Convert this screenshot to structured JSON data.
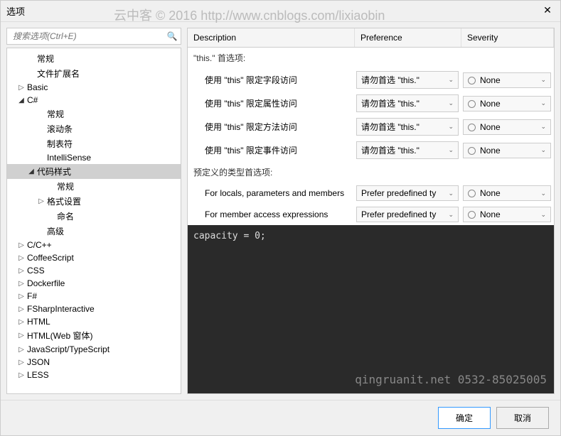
{
  "watermark": "云中客 © 2016 http://www.cnblogs.com/lixiaobin",
  "title": "选项",
  "search": {
    "placeholder": "搜索选项(Ctrl+E)"
  },
  "tree": {
    "items": [
      {
        "label": "常规",
        "indent": 2,
        "arrow": ""
      },
      {
        "label": "文件扩展名",
        "indent": 2,
        "arrow": ""
      },
      {
        "label": "Basic",
        "indent": 1,
        "arrow": "▷"
      },
      {
        "label": "C#",
        "indent": 1,
        "arrow": "◢"
      },
      {
        "label": "常规",
        "indent": 3,
        "arrow": ""
      },
      {
        "label": "滚动条",
        "indent": 3,
        "arrow": ""
      },
      {
        "label": "制表符",
        "indent": 3,
        "arrow": ""
      },
      {
        "label": "IntelliSense",
        "indent": 3,
        "arrow": ""
      },
      {
        "label": "代码样式",
        "indent": 2,
        "arrow": "◢",
        "selected": true
      },
      {
        "label": "常规",
        "indent": 4,
        "arrow": ""
      },
      {
        "label": "格式设置",
        "indent": 3,
        "arrow": "▷"
      },
      {
        "label": "命名",
        "indent": 4,
        "arrow": ""
      },
      {
        "label": "高级",
        "indent": 3,
        "arrow": ""
      },
      {
        "label": "C/C++",
        "indent": 1,
        "arrow": "▷"
      },
      {
        "label": "CoffeeScript",
        "indent": 1,
        "arrow": "▷"
      },
      {
        "label": "CSS",
        "indent": 1,
        "arrow": "▷"
      },
      {
        "label": "Dockerfile",
        "indent": 1,
        "arrow": "▷"
      },
      {
        "label": "F#",
        "indent": 1,
        "arrow": "▷"
      },
      {
        "label": "FSharpInteractive",
        "indent": 1,
        "arrow": "▷"
      },
      {
        "label": "HTML",
        "indent": 1,
        "arrow": "▷"
      },
      {
        "label": "HTML(Web 窗体)",
        "indent": 1,
        "arrow": "▷"
      },
      {
        "label": "JavaScript/TypeScript",
        "indent": 1,
        "arrow": "▷"
      },
      {
        "label": "JSON",
        "indent": 1,
        "arrow": "▷"
      },
      {
        "label": "LESS",
        "indent": 1,
        "arrow": "▷"
      }
    ]
  },
  "grid": {
    "headers": {
      "description": "Description",
      "preference": "Preference",
      "severity": "Severity"
    },
    "group1": "\"this.\" 首选项:",
    "rows1": [
      {
        "desc": "使用 \"this\" 限定字段访问",
        "pref": "请勿首选 \"this.\"",
        "sev": "None"
      },
      {
        "desc": "使用 \"this\" 限定属性访问",
        "pref": "请勿首选 \"this.\"",
        "sev": "None"
      },
      {
        "desc": "使用 \"this\" 限定方法访问",
        "pref": "请勿首选 \"this.\"",
        "sev": "None"
      },
      {
        "desc": "使用 \"this\" 限定事件访问",
        "pref": "请勿首选 \"this.\"",
        "sev": "None"
      }
    ],
    "group2": "预定义的类型首选项:",
    "rows2": [
      {
        "desc": "For locals, parameters and members",
        "pref": "Prefer predefined ty",
        "sev": "None"
      },
      {
        "desc": "For member access expressions",
        "pref": "Prefer predefined ty",
        "sev": "None"
      }
    ]
  },
  "code": "capacity = 0;",
  "code_watermark": "qingruanit.net 0532-85025005",
  "buttons": {
    "ok": "确定",
    "cancel": "取消"
  }
}
